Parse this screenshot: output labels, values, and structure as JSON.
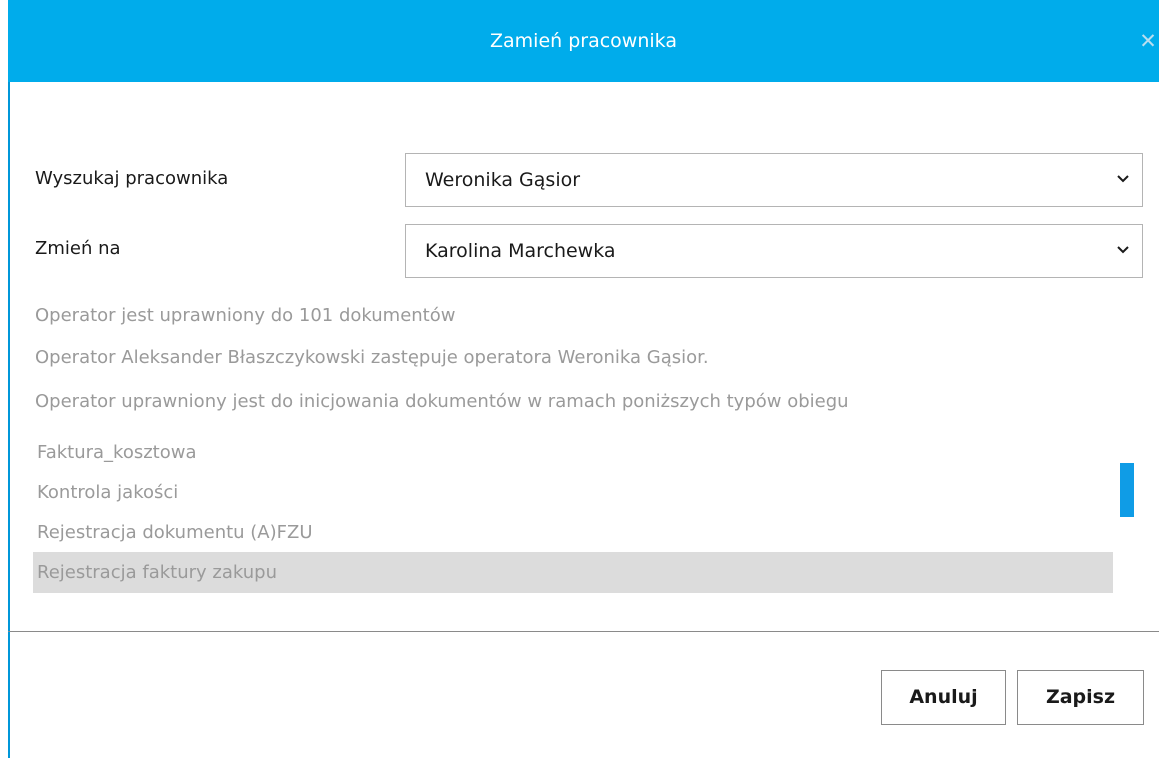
{
  "dialog": {
    "title": "Zamień pracownika",
    "close_icon": "close-icon"
  },
  "form": {
    "search_label": "Wyszukaj pracownika",
    "search_value": "Weronika Gąsior",
    "change_label": "Zmień na",
    "change_value": "Karolina Marchewka"
  },
  "info": {
    "line1": "Operator jest uprawniony do 101 dokumentów",
    "line2": "Operator Aleksander Błaszczykowski zastępuje operatora Weronika Gąsior.",
    "line3": "Operator uprawniony jest do inicjowania dokumentów w ramach poniższych typów obiegu"
  },
  "workflow_list": {
    "items": [
      {
        "label": "Faktura_kosztowa",
        "selected": false
      },
      {
        "label": "Kontrola jakości",
        "selected": false
      },
      {
        "label": "Rejestracja dokumentu (A)FZU",
        "selected": false
      },
      {
        "label": "Rejestracja faktury zakupu",
        "selected": true
      }
    ]
  },
  "buttons": {
    "cancel_label": "Anuluj",
    "save_label": "Zapisz"
  },
  "colors": {
    "title_bar": "#00aceb",
    "scrollbar": "#0f9ce6",
    "selected_row": "#dcdcdc"
  }
}
